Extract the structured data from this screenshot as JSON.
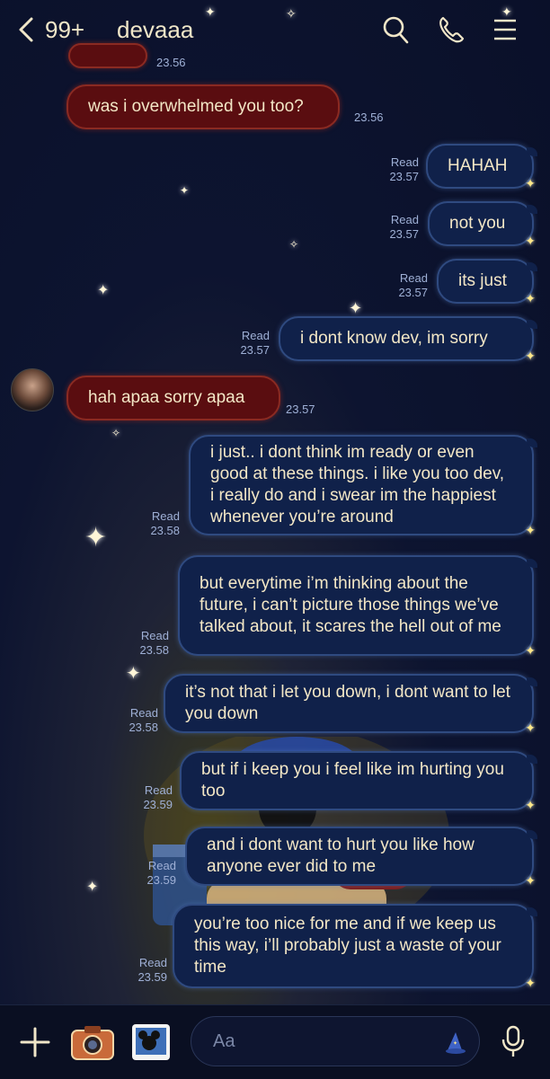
{
  "header": {
    "unread_count": "99+",
    "contact_name": "devaaa"
  },
  "messages": [
    {
      "from": "other",
      "text": "was i overwhelmed you too?",
      "time": "23.56"
    },
    {
      "from": "me",
      "text": "HAHAH",
      "status": "Read",
      "time": "23.57"
    },
    {
      "from": "me",
      "text": "not you",
      "status": "Read",
      "time": "23.57"
    },
    {
      "from": "me",
      "text": "its just",
      "status": "Read",
      "time": "23.57"
    },
    {
      "from": "me",
      "text": "i dont know dev, im sorry",
      "status": "Read",
      "time": "23.57"
    },
    {
      "from": "other",
      "text": "hah apaa sorry apaa",
      "time": "23.57"
    },
    {
      "from": "me",
      "text": "i just.. i dont think im ready or even good at these things. i like you too dev, i really do and i swear im the happiest whenever you’re around",
      "status": "Read",
      "time": "23.58"
    },
    {
      "from": "me",
      "text": "but everytime i’m thinking about the future, i can’t picture those things we’ve talked about, it scares the hell out of me",
      "status": "Read",
      "time": "23.58"
    },
    {
      "from": "me",
      "text": "it’s not that i let you down, i dont want to let you down",
      "status": "Read",
      "time": "23.58"
    },
    {
      "from": "me",
      "text": "but if i keep you i feel like im hurting you too",
      "status": "Read",
      "time": "23.59"
    },
    {
      "from": "me",
      "text": "and i dont want to hurt you like how anyone ever did to me",
      "status": "Read",
      "time": "23.59"
    },
    {
      "from": "me",
      "text": "you’re too nice for me and if we keep us this way, i’ll probably just a waste of your time",
      "status": "Read",
      "time": "23.59"
    }
  ],
  "clipped_top_time": "23.56",
  "composer": {
    "placeholder": "Aa"
  },
  "icons": {
    "back": "chevron-left-icon",
    "search": "search-icon",
    "call": "phone-icon",
    "menu": "menu-icon",
    "plus": "plus-icon",
    "camera": "camera-icon",
    "photo": "photo-icon",
    "sticker": "wizard-hat-icon",
    "mic": "microphone-icon"
  },
  "colors": {
    "received_bubble": "#5a0d10",
    "sent_bubble": "#10214a",
    "text": "#f3e7c6",
    "timestamp": "#9fb0d6"
  }
}
